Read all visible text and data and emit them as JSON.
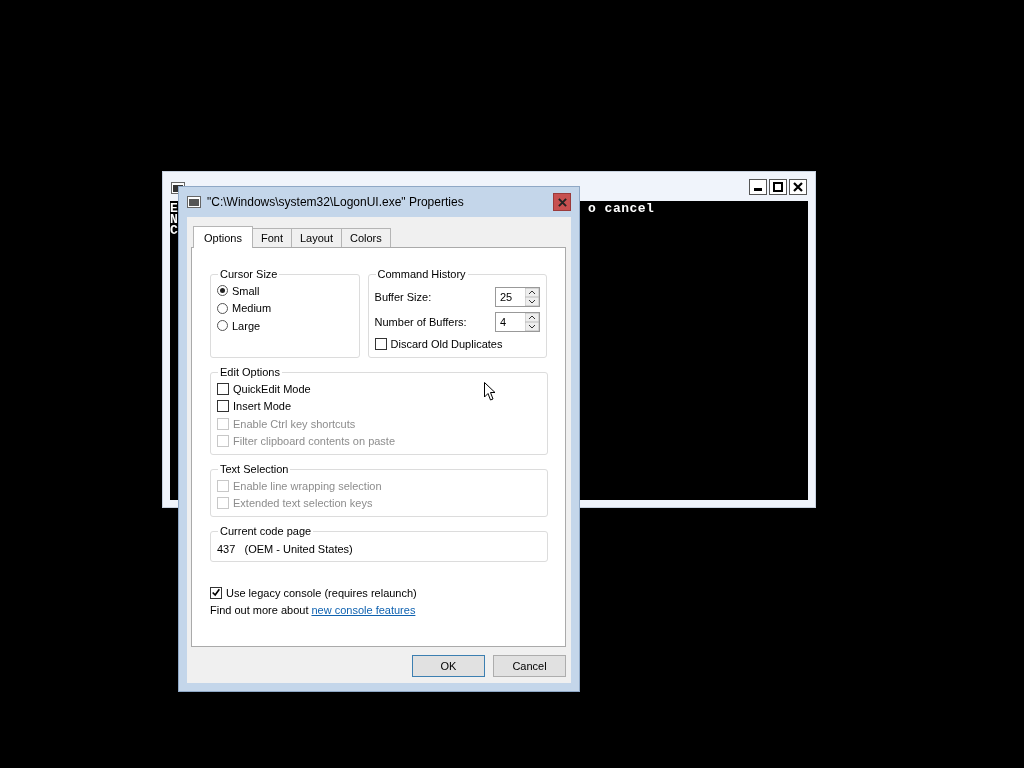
{
  "console": {
    "lines": [
      "E",
      "N",
      "C"
    ],
    "visible_text": "o cancel"
  },
  "dialog": {
    "title": "\"C:\\Windows\\system32\\LogonUI.exe\" Properties",
    "tabs": [
      {
        "label": "Options",
        "selected": true
      },
      {
        "label": "Font",
        "selected": false
      },
      {
        "label": "Layout",
        "selected": false
      },
      {
        "label": "Colors",
        "selected": false
      }
    ],
    "cursor_size": {
      "title": "Cursor Size",
      "options": [
        {
          "label": "Small",
          "selected": true
        },
        {
          "label": "Medium",
          "selected": false
        },
        {
          "label": "Large",
          "selected": false
        }
      ]
    },
    "command_history": {
      "title": "Command History",
      "fields": [
        {
          "label": "Buffer Size:",
          "value": "25"
        },
        {
          "label": "Number of Buffers:",
          "value": "4"
        }
      ],
      "checkbox": {
        "label": "Discard Old Duplicates",
        "checked": false
      }
    },
    "edit_options": {
      "title": "Edit Options",
      "options": [
        {
          "label": "QuickEdit Mode",
          "checked": false,
          "disabled": false
        },
        {
          "label": "Insert Mode",
          "checked": false,
          "disabled": false
        },
        {
          "label": "Enable Ctrl key shortcuts",
          "checked": false,
          "disabled": true
        },
        {
          "label": "Filter clipboard contents on paste",
          "checked": false,
          "disabled": true
        }
      ]
    },
    "text_selection": {
      "title": "Text Selection",
      "options": [
        {
          "label": "Enable line wrapping selection",
          "checked": false,
          "disabled": true
        },
        {
          "label": "Extended text selection keys",
          "checked": false,
          "disabled": true
        }
      ]
    },
    "code_page": {
      "title": "Current code page",
      "value": "437   (OEM - United States)"
    },
    "legacy": {
      "label": "Use legacy console (requires relaunch)",
      "checked": true
    },
    "more_info": {
      "text": "Find out more about",
      "link": "new console features"
    },
    "buttons": [
      {
        "label": "OK",
        "default": true
      },
      {
        "label": "Cancel",
        "default": false
      }
    ]
  }
}
